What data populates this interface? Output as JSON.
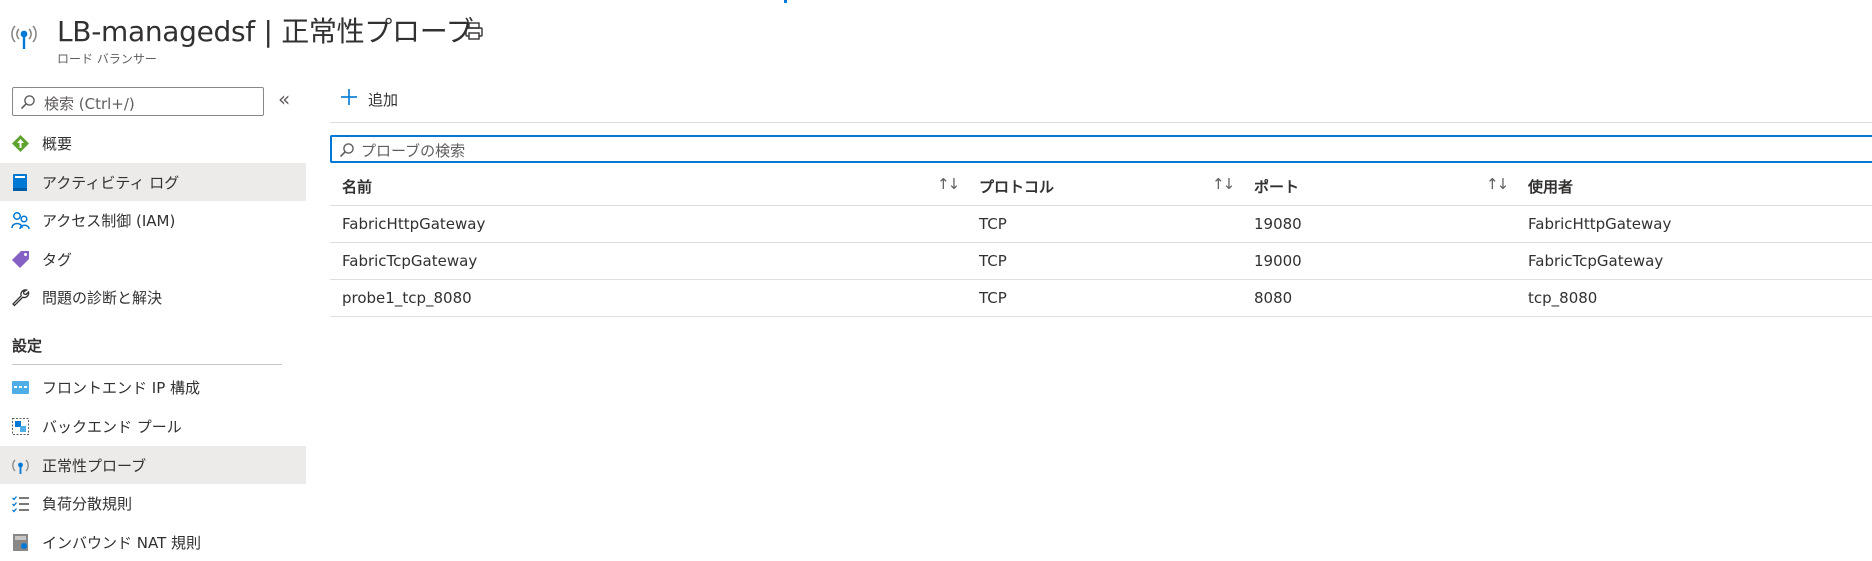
{
  "header": {
    "title": "LB-managedsf | 正常性プローブ",
    "subtitle": "ロード バランサー"
  },
  "sidebar": {
    "search_placeholder": "検索 (Ctrl+/)",
    "collapse_glyph": "«",
    "items": [
      {
        "label": "概要",
        "icon": "overview-icon"
      },
      {
        "label": "アクティビティ ログ",
        "icon": "activity-log-icon"
      },
      {
        "label": "アクセス制御 (IAM)",
        "icon": "iam-icon"
      },
      {
        "label": "タグ",
        "icon": "tag-icon"
      },
      {
        "label": "問題の診断と解決",
        "icon": "wrench-icon"
      }
    ],
    "section_header": "設定",
    "settings_items": [
      {
        "label": "フロントエンド IP 構成",
        "icon": "frontend-ip-icon"
      },
      {
        "label": "バックエンド プール",
        "icon": "backend-pool-icon"
      },
      {
        "label": "正常性プローブ",
        "icon": "health-probe-icon"
      },
      {
        "label": "負荷分散規則",
        "icon": "lb-rules-icon"
      },
      {
        "label": "インバウンド NAT 規則",
        "icon": "inbound-nat-icon"
      }
    ]
  },
  "toolbar": {
    "add_label": "追加"
  },
  "probe_search": {
    "placeholder": "プローブの検索"
  },
  "table": {
    "columns": [
      "名前",
      "プロトコル",
      "ポート",
      "使用者"
    ],
    "sort_glyph": "↑↓",
    "rows": [
      [
        "FabricHttpGateway",
        "TCP",
        "19080",
        "FabricHttpGateway"
      ],
      [
        "FabricTcpGateway",
        "TCP",
        "19000",
        "FabricTcpGateway"
      ],
      [
        "probe1_tcp_8080",
        "TCP",
        "8080",
        "tcp_8080"
      ]
    ]
  },
  "colors": {
    "accent": "#0078d4",
    "selected_bg": "#edebe9",
    "text": "#323130"
  }
}
